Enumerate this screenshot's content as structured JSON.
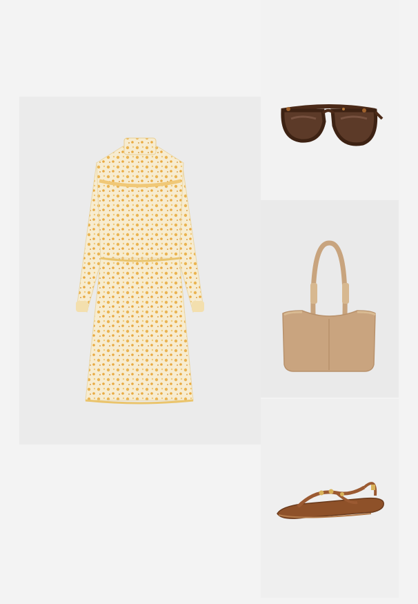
{
  "outfit": {
    "items": [
      {
        "id": "dress",
        "icon": "floral-dress-image",
        "label": ""
      },
      {
        "id": "sunglasses",
        "icon": "tortoiseshell-sunglasses-image",
        "label": ""
      },
      {
        "id": "bag",
        "icon": "tan-shoulder-bag-image",
        "label": ""
      },
      {
        "id": "sandals",
        "icon": "brown-thong-sandal-image",
        "label": ""
      }
    ],
    "colors": {
      "page_background": "#f3f3f3",
      "dress_base": "#f6e9c7",
      "dress_print": "#e8b24a",
      "tortoise": "#5a3420",
      "bag": "#c9a47f",
      "sandal": "#9b5a32"
    }
  }
}
